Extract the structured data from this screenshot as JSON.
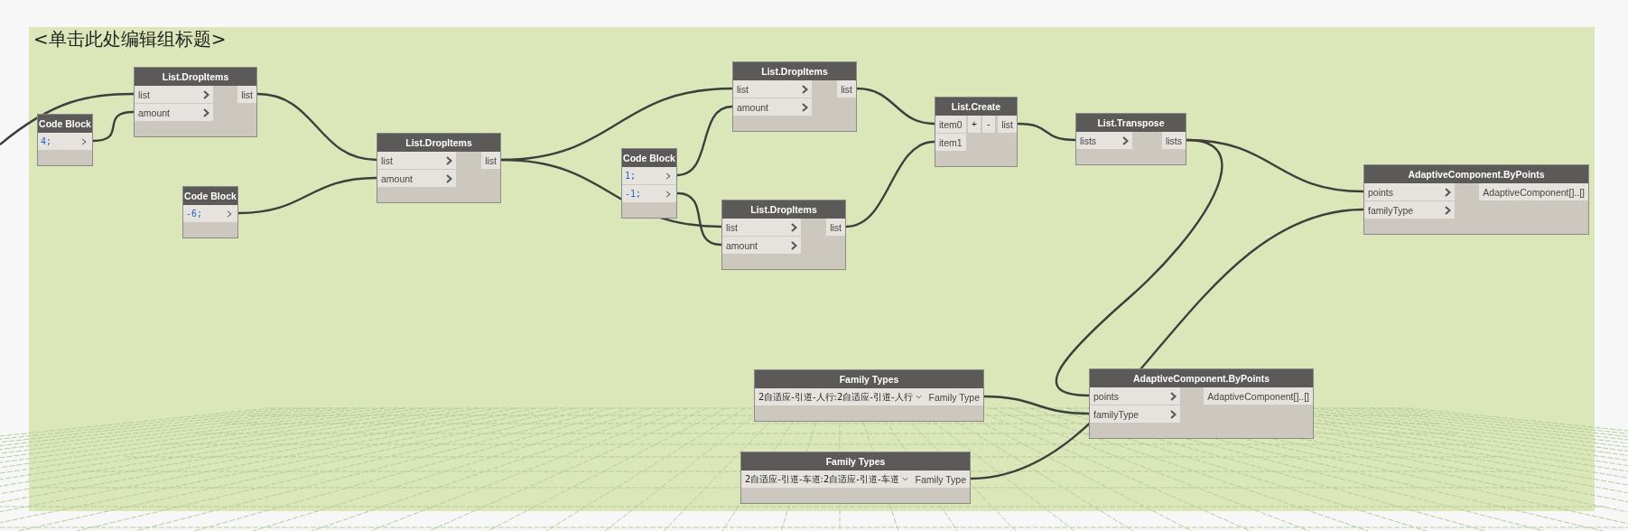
{
  "group": {
    "title": "<单击此处编辑组标题>"
  },
  "nodes": [
    {
      "kind": "function",
      "title": "List.DropItems",
      "inputs": [
        "list",
        "amount"
      ],
      "outputs": [
        "list"
      ]
    },
    {
      "kind": "code",
      "title": "Code Block",
      "lines": [
        "4;"
      ]
    },
    {
      "kind": "code",
      "title": "Code Block",
      "lines": [
        "-6;"
      ]
    },
    {
      "kind": "function",
      "title": "List.DropItems",
      "inputs": [
        "list",
        "amount"
      ],
      "outputs": [
        "list"
      ]
    },
    {
      "kind": "function",
      "title": "List.DropItems",
      "inputs": [
        "list",
        "amount"
      ],
      "outputs": [
        "list"
      ]
    },
    {
      "kind": "code",
      "title": "Code Block",
      "lines": [
        "1;",
        "-1;"
      ]
    },
    {
      "kind": "function",
      "title": "List.DropItems",
      "inputs": [
        "list",
        "amount"
      ],
      "outputs": [
        "list"
      ]
    },
    {
      "kind": "create",
      "title": "List.Create",
      "inputs": [
        "item0",
        "item1"
      ],
      "buttons": [
        "+",
        "-"
      ],
      "outputs": [
        "list"
      ]
    },
    {
      "kind": "function",
      "title": "List.Transpose",
      "inputs": [
        "lists"
      ],
      "outputs": [
        "lists"
      ]
    },
    {
      "kind": "function",
      "title": "AdaptiveComponent.ByPoints",
      "inputs": [
        "points",
        "familyType"
      ],
      "outputs": [
        "AdaptiveComponent[]..[]"
      ]
    },
    {
      "kind": "family",
      "title": "Family Types",
      "value": "2自适应-引道-人行:2自适应-引道-人行",
      "outputs": [
        "Family Type"
      ]
    },
    {
      "kind": "function",
      "title": "AdaptiveComponent.ByPoints",
      "inputs": [
        "points",
        "familyType"
      ],
      "outputs": [
        "AdaptiveComponent[]..[]"
      ]
    },
    {
      "kind": "family",
      "title": "Family Types",
      "value": "2自适应-引道-车道:2自适应-引道-车道",
      "outputs": [
        "Family Type"
      ]
    }
  ]
}
